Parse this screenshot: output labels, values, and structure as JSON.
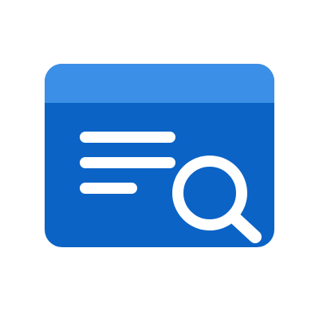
{
  "icon": {
    "name": "document-search-icon",
    "colors": {
      "background": "#ffffff",
      "panel": "#0b63c6",
      "header": "#3b8fe6",
      "foreground": "#ffffff"
    }
  }
}
